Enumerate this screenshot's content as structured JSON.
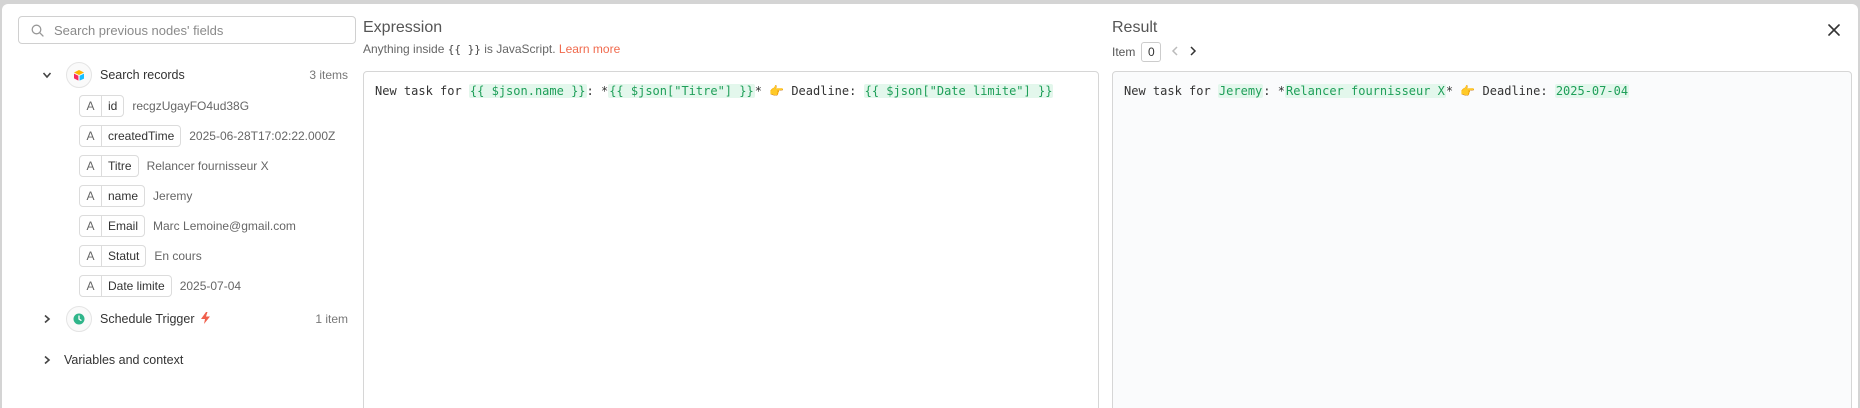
{
  "search": {
    "placeholder": "Search previous nodes' fields"
  },
  "nodes": {
    "search_records": {
      "label": "Search records",
      "count": "3 items",
      "fields": [
        {
          "type": "A",
          "name": "id",
          "value": "recgzUgayFO4ud38G"
        },
        {
          "type": "A",
          "name": "createdTime",
          "value": "2025-06-28T17:02:22.000Z"
        },
        {
          "type": "A",
          "name": "Titre",
          "value": "Relancer fournisseur X"
        },
        {
          "type": "A",
          "name": "name",
          "value": "Jeremy"
        },
        {
          "type": "A",
          "name": "Email",
          "value": "Marc Lemoine@gmail.com"
        },
        {
          "type": "A",
          "name": "Statut",
          "value": "En cours"
        },
        {
          "type": "A",
          "name": "Date limite",
          "value": "2025-07-04"
        }
      ]
    },
    "schedule_trigger": {
      "label": "Schedule Trigger",
      "count": "1 item"
    },
    "variables": {
      "label": "Variables and context"
    }
  },
  "expression": {
    "title": "Expression",
    "hint_prefix": "Anything inside",
    "hint_code": "{{ }}",
    "hint_suffix": "is JavaScript.",
    "hint_link": "Learn more",
    "segments": {
      "t1": "New task for ",
      "e1": "{{ $json.name }}",
      "t2": ": *",
      "e2": "{{ $json[\"Titre\"] }}",
      "t3": "* ",
      "emoji": "👉",
      "t4": " Deadline: ",
      "e3": "{{ $json[\"Date limite\"] }}"
    }
  },
  "result": {
    "title": "Result",
    "item_label": "Item",
    "item_value": "0",
    "segments": {
      "t1": "New task for ",
      "r1": "Jeremy",
      "t2": ": *",
      "r2": "Relancer fournisseur X",
      "t3": "* ",
      "emoji": "👉",
      "t4": " Deadline: ",
      "r3": "2025-07-04"
    }
  },
  "colors": {
    "accent_link": "#f06a4d",
    "highlight_bg": "#e3f7ec",
    "highlight_fg": "#1f9f59"
  },
  "icons": [
    "search-icon",
    "chevron-down-icon",
    "chevron-right-icon",
    "airtable-icon",
    "clock-icon",
    "bolt-icon",
    "close-icon"
  ]
}
